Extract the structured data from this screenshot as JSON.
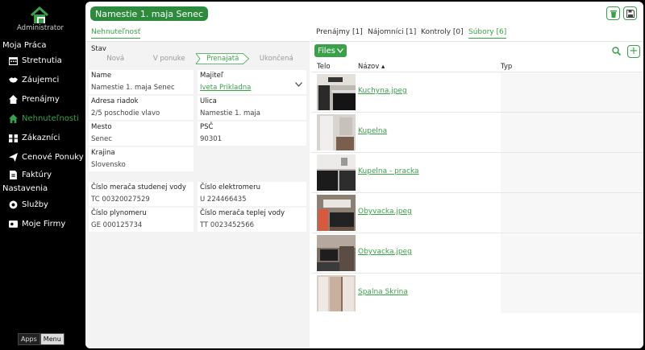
{
  "sidebar": {
    "brand": "Administrator",
    "sections": [
      "Moja Práca",
      "Nastavenia"
    ],
    "items": [
      {
        "label": "Stretnutia",
        "icon": "calendar-icon",
        "active": false
      },
      {
        "label": "Záujemci",
        "icon": "handshake-icon",
        "active": false
      },
      {
        "label": "Prenájmy",
        "icon": "house-key-icon",
        "active": false
      },
      {
        "label": "Nehnuteľnosti",
        "icon": "home-icon",
        "active": true
      },
      {
        "label": "Zákazníci",
        "icon": "users-icon",
        "active": false
      },
      {
        "label": "Cenové Ponuky",
        "icon": "send-icon",
        "active": false
      },
      {
        "label": "Faktúry",
        "icon": "invoice-icon",
        "active": false
      },
      {
        "label": "Služby",
        "icon": "services-icon",
        "active": false
      },
      {
        "label": "Moje Firmy",
        "icon": "company-icon",
        "active": false
      }
    ],
    "bottom": {
      "apps": "Apps",
      "menu": "Menu"
    }
  },
  "header": {
    "title": "Namestie 1. maja Senec"
  },
  "left_tab": "Nehnuteľnosť",
  "right_tabs": [
    "Prenájmy [1]",
    "Nájomníci [1]",
    "Kontroly [0]",
    "Súbory [6]"
  ],
  "form": {
    "stav_label": "Stav",
    "steps": [
      "Nová",
      "V ponuke",
      "Prenajatá",
      "Ukončená"
    ],
    "active_step": 2,
    "name": {
      "label": "Name",
      "value": "Namestie 1. maja Senec"
    },
    "majitel": {
      "label": "Majiteľ",
      "value": "Iveta Prikladna"
    },
    "adresa": {
      "label": "Adresa riadok",
      "value": "2/5 poschodie vlavo"
    },
    "ulica": {
      "label": "Ulica",
      "value": "Namestie 1. maja"
    },
    "mesto": {
      "label": "Mesto",
      "value": "Senec"
    },
    "psc": {
      "label": "PSČ",
      "value": "90301"
    },
    "krajina": {
      "label": "Krajina",
      "value": "Slovensko"
    },
    "voda_studena": {
      "label": "Číslo merača studenej vody",
      "value": "TC 00320027529"
    },
    "elektromer": {
      "label": "Číslo elektromeru",
      "value": "U 224466435"
    },
    "plynomer": {
      "label": "Číslo plynomeru",
      "value": "GE 000125734"
    },
    "voda_tepla": {
      "label": "Číslo merača teplej vody",
      "value": "TT 0023452566"
    }
  },
  "files": {
    "button": "Files",
    "columns": [
      "Telo",
      "Názov ▴",
      "Typ"
    ],
    "rows": [
      {
        "name": "Kuchyna.jpeg"
      },
      {
        "name": "Kupelna"
      },
      {
        "name": "Kupelna - pracka"
      },
      {
        "name": "Obyvacka.jpeg"
      },
      {
        "name": "Obyvacka.jpeg"
      },
      {
        "name": "Spalna Skrina"
      }
    ]
  },
  "colors": {
    "accent": "#3aa14a",
    "title_bg": "#2e8b3d"
  }
}
